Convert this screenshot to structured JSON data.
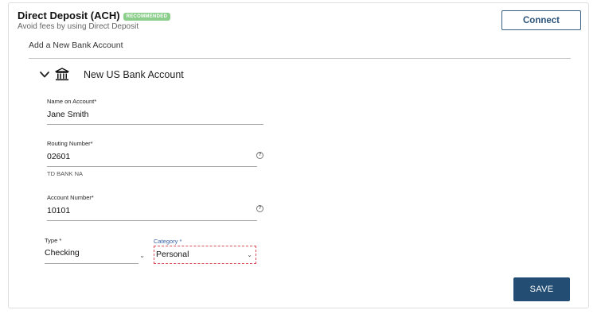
{
  "header": {
    "title": "Direct Deposit (ACH)",
    "badge": "RECOMMENDED",
    "subtitle": "Avoid fees by using Direct Deposit",
    "connect_label": "Connect"
  },
  "section": {
    "label": "Add a New Bank Account"
  },
  "account": {
    "title": "New US Bank Account",
    "chevron_icon": "chevron-down-icon",
    "bank_icon": "bank-icon"
  },
  "form": {
    "name": {
      "label": "Name on Account*",
      "value": "Jane Smith"
    },
    "routing": {
      "label": "Routing Number*",
      "value": "02601",
      "hint": "TD BANK NA",
      "help": "?"
    },
    "account_number": {
      "label": "Account Number*",
      "value": "10101",
      "help": "?"
    },
    "type": {
      "label": "Type *",
      "value": "Checking"
    },
    "category": {
      "label": "Category *",
      "value": "Personal"
    }
  },
  "actions": {
    "save_label": "SAVE"
  },
  "colors": {
    "primary": "#244d74",
    "badge": "#8ccf8c",
    "category_label": "#3b63a6",
    "invalid_border": "#d9505a"
  }
}
